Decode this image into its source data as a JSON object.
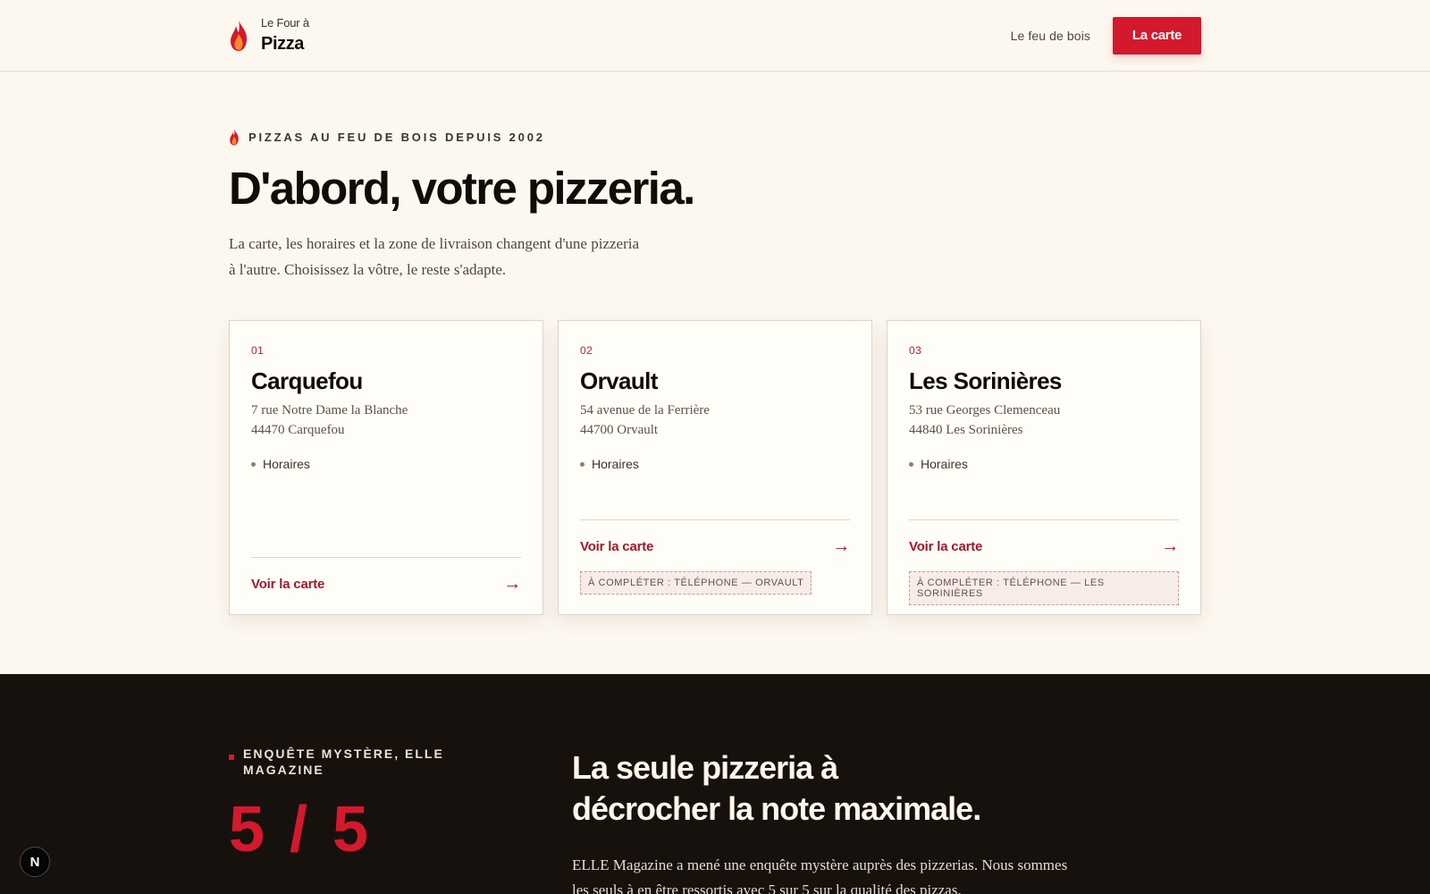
{
  "header": {
    "brand_small": "Le Four à",
    "brand_big": "Pizza",
    "nav_link": "Le feu de bois",
    "nav_cta": "La carte"
  },
  "hero": {
    "eyebrow": "PIZZAS AU FEU DE BOIS DEPUIS 2002",
    "title": "D'abord, votre pizzeria.",
    "subtitle": "La carte, les horaires et la zone de livraison changent d'une pizzeria à l'autre. Choisissez la vôtre, le reste s'adapte."
  },
  "cards": [
    {
      "num": "01",
      "name": "Carquefou",
      "addr1": "7 rue Notre Dame la Blanche",
      "addr2": "44470 Carquefou",
      "hours": "Horaires",
      "link": "Voir la carte",
      "arrow": "→",
      "badge": ""
    },
    {
      "num": "02",
      "name": "Orvault",
      "addr1": "54 avenue de la Ferrière",
      "addr2": "44700 Orvault",
      "hours": "Horaires",
      "link": "Voir la carte",
      "arrow": "→",
      "badge": "À COMPLÉTER : TÉLÉPHONE — ORVAULT"
    },
    {
      "num": "03",
      "name": "Les Sorinières",
      "addr1": "53 rue Georges Clemenceau",
      "addr2": "44840 Les Sorinières",
      "hours": "Horaires",
      "link": "Voir la carte",
      "arrow": "→",
      "badge": "À COMPLÉTER : TÉLÉPHONE — LES SORINIÈRES"
    }
  ],
  "press": {
    "label": "ENQUÊTE MYSTÈRE, ELLE MAGAZINE",
    "score": "5 / 5",
    "title_line1": "La seule pizzeria à",
    "title_line2": "décrocher la note maximale.",
    "text": "ELLE Magazine a mené une enquête mystère auprès des pizzerias. Nous sommes les seuls à en être ressortis avec 5 sur 5 sur la qualité des pizzas."
  },
  "dev_badge": "N",
  "colors": {
    "accent": "#d4192d",
    "background": "#fcf7ef",
    "dark_band": "#17110e",
    "link": "#9c1b2d"
  }
}
